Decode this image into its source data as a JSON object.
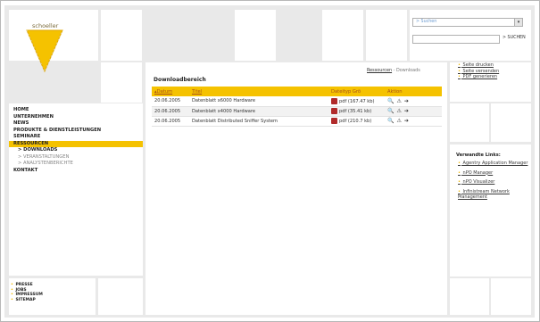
{
  "logo": {
    "text": "schoeller"
  },
  "search": {
    "category": "> Suchen",
    "button": "> SUCHEN"
  },
  "nav": [
    {
      "label": "HOME"
    },
    {
      "label": "UNTERNEHMEN"
    },
    {
      "label": "NEWS"
    },
    {
      "label": "PRODUKTE & DIENSTLEISTUNGEN"
    },
    {
      "label": "SEMINARE"
    },
    {
      "label": "RESSOURCEN",
      "active": true
    }
  ],
  "subnav": [
    "> DOWNLOADS",
    "> VERANSTALTUNGEN",
    "> ANALYSTENBERICHTE"
  ],
  "nav_last": "KONTAKT",
  "footer": [
    "PRESSE",
    "JOBS",
    "IMPRESSUM",
    "SITEMAP"
  ],
  "breadcrumb": {
    "parent": "Ressourcen",
    "sep": "-",
    "current": "Downloads"
  },
  "page_title": "Downloadbereich",
  "table": {
    "headers": [
      "Datum",
      "Titel",
      "Dateityp Grö",
      "Aktion"
    ],
    "rows": [
      {
        "date": "20.06.2005",
        "title": "Datenblatt x6000 Hardware",
        "file": "pdf (167.47 kb)"
      },
      {
        "date": "20.06.2005",
        "title": "Datenblatt x4000 Hardware",
        "file": "pdf (35.41 kb)"
      },
      {
        "date": "20.06.2005",
        "title": "Datenblatt Distributed Sniffer System",
        "file": "pdf (210.7 kb)"
      }
    ]
  },
  "tools": [
    "Seite drucken",
    "Seite versenden",
    "PDF generieren"
  ],
  "related_title": "Verwandte Links:",
  "related": [
    "Agentry Application Manager",
    "nPO Manager",
    "nPO Visualizer",
    "Infinistream Network Management"
  ],
  "colors": {
    "accent": "#f5c200",
    "bg": "#e9e9e9"
  }
}
